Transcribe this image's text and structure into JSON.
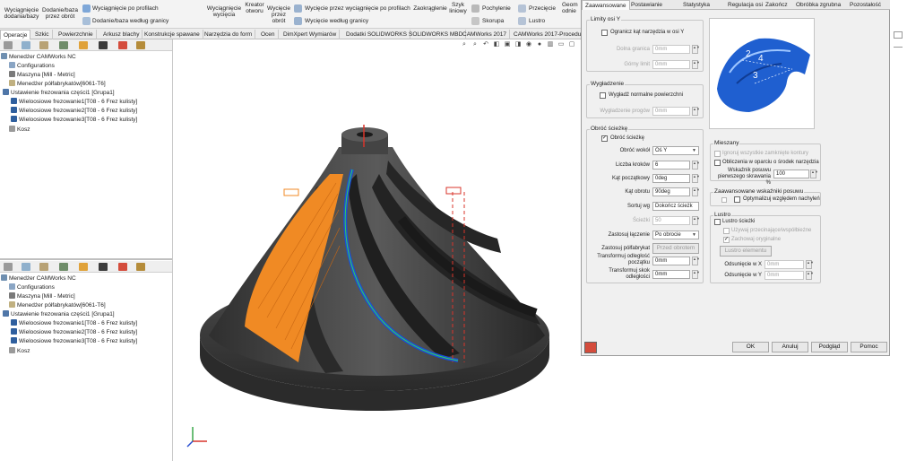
{
  "ribbon": {
    "btn_extrude_base": "Wyciągnięcie\ndodania/bazy",
    "btn_revolve_base": "Dodanie/baza\nprzez obrót",
    "btn_sweep": "Wyciągnięcie po profilach",
    "btn_loft_base": "Dodanie/baza według granicy",
    "btn_extrude_cut": "Wyciągnięcie\nwycięcia",
    "btn_hole_wizard": "Kreator\notworu",
    "btn_revolve_cut": "Wycięcie\nprzez\nobrót",
    "btn_swept_cut": "Wycięcie przez wyciągnięcie po profilach",
    "btn_boundary_cut": "Wycięcie według granicy",
    "btn_fillet": "Zaokrąglenie",
    "btn_linear_pattern": "Szyk\nliniowy",
    "btn_draft": "Pochylenie",
    "btn_intersect": "Przecięcie",
    "btn_shell": "Skorupa",
    "btn_mirror": "Lustro",
    "btn_geometry": "Geom\nodnie"
  },
  "command_tabs": [
    "Operacje",
    "Szkic",
    "Powierzchnie",
    "Arkusz blachy",
    "Konstrukcje spawane",
    "Narzędzia do form",
    "Ocen",
    "DimXpert Wymiarów",
    "Dodatki SOLIDWORKS",
    "SOLIDWORKS MBD",
    "CAMWorks 2017",
    "CAMWorks 2017-Procedu"
  ],
  "tree_top": {
    "root": "Menedżer CAMWorks NC",
    "configurations": "Configurations",
    "machine": "Maszyna [Mill - Metric]",
    "stock": "Menedżer półfabrykatów[6061-T6]",
    "setup": "Ustawienie frezowania części1 [Grupa1]",
    "op1": "Wieloosiowe frezowanie1[T08 - 6 Frez kulisty]",
    "op2": "Wieloosiowe frezowanie2[T08 - 6 Frez kulisty]",
    "op3": "Wieloosiowe frezowanie3[T08 - 6 Frez kulisty]",
    "recycle": "Kosz"
  },
  "tree_bottom": {
    "root": "Menedżer CAMWorks NC",
    "configurations": "Configurations",
    "machine": "Maszyna [Mill - Metric]",
    "stock": "Menedżer półfabrykatów[6061-T6]",
    "setup": "Ustawienie frezowania części1 [Grupa1]",
    "op1": "Wieloosiowe frezowanie1[T08 - 6 Frez kulisty]",
    "op2": "Wieloosiowe frezowanie2[T08 - 6 Frez kulisty]",
    "op3": "Wieloosiowe frezowanie3[T08 - 6 Frez kulisty]",
    "recycle": "Kosz"
  },
  "dialog": {
    "tabs": [
      "Zaawansowane",
      "Postawianie",
      "Statystyka",
      "Regulacja osi",
      "Zakończ",
      "Obróbka zgrubna",
      "Pozostałość"
    ],
    "grp_y_limits": "Limity osi Y",
    "chk_limit_y": "Ogranicz kąt narzędzia w osi Y",
    "lbl_lower": "Dolna granica",
    "val_lower": "0mm",
    "lbl_upper": "Górny limit",
    "val_upper": "0mm",
    "grp_smoothing": "Wygładzenie",
    "chk_smooth": "Wygładź normalne powierzchni",
    "lbl_smooth_radius": "Wygładzenie progów",
    "val_smooth_radius": "0mm",
    "grp_rotate": "Obróć ścieżkę",
    "chk_rotate": "Obróć ścieżkę",
    "lbl_rotate_axis": "Obróć wokół",
    "val_rotate_axis": "Oś Y",
    "lbl_count": "Liczba kroków",
    "val_count": "6",
    "lbl_start_angle": "Kąt początkowy",
    "val_start_angle": "0deg",
    "lbl_rotate_angle": "Kąt obrotu",
    "val_rotate_angle": "90deg",
    "lbl_sort": "Sortuj wg",
    "val_sort": "Dokończ ścieżk",
    "lbl_paths": "Ścieżki",
    "val_paths": "50",
    "lbl_link": "Zastosuj łączenie",
    "val_link": "Po obrocie",
    "lbl_apply_stock": "Zastosuj półfabrykat",
    "btn_stock": "Przed obrotem",
    "lbl_transform_start": "Transformuj odległość\npoczątku",
    "val_transform_start": "0mm",
    "lbl_transform_step": "Transformuj skok\nodległości",
    "val_transform_step": "0mm",
    "grp_mix": "Mieszany",
    "chk_ignore": "Ignoruj wszystkie zamknięte kontury",
    "chk_compute": "Obliczenia w oparciu o środek narzędzia",
    "lbl_feed": "Wskaźnik posuwu\npierwszego skrawania %",
    "val_feed": "100",
    "grp_advanced": "Zaawansowane wskaźniki posuwu",
    "chk_optimize": "Optymalizuj względem nachyleń",
    "grp_mirror": "Lustro",
    "chk_mirror": "Lustro ścieżki",
    "chk_use_coord": "Używaj przecinające/współbieżne",
    "chk_keep_order": "Zachowaj oryginalne",
    "btn_mirror_elem": "Lustro elementu",
    "lbl_offset_x": "Odsunięcie w X",
    "val_offset_x": "0mm",
    "lbl_offset_y": "Odsunięcie w Y",
    "val_offset_y": "0mm",
    "btn_ok": "OK",
    "btn_cancel": "Anuluj",
    "btn_preview": "Podgląd",
    "btn_help": "Pomoc",
    "preview_labels": [
      "2",
      "4",
      "3"
    ]
  },
  "colors": {
    "model_dark": "#3a3a3a",
    "toolpath_orange": "#f08a24",
    "toolpath_blue": "#1c4fd6",
    "accent_red": "#d9342b"
  }
}
